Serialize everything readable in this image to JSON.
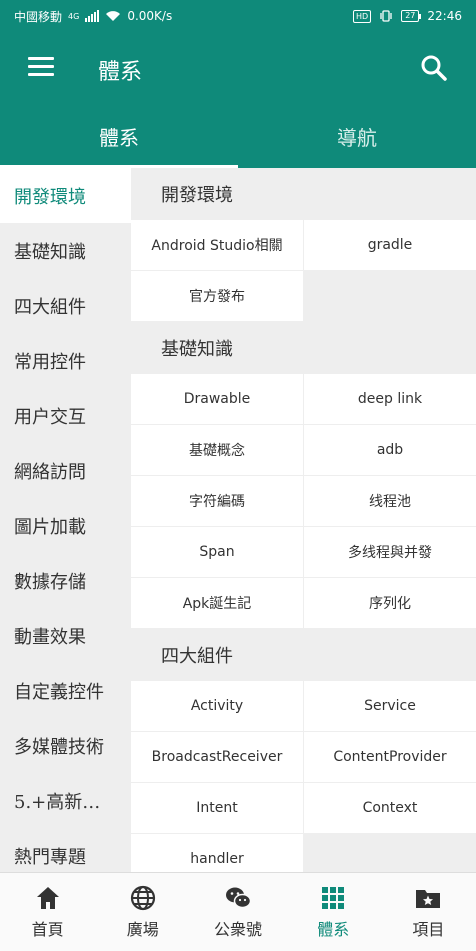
{
  "status_bar": {
    "carrier": "中國移動",
    "network": "4G",
    "speed": "0.00K/s",
    "hd": "HD",
    "battery": "27",
    "time": "22:46"
  },
  "app_bar": {
    "title": "體系",
    "menu_icon": "menu-icon",
    "search_icon": "search-icon",
    "color": "#0f8a7a"
  },
  "top_tabs": [
    {
      "label": "體系",
      "active": true
    },
    {
      "label": "導航",
      "active": false
    }
  ],
  "sidebar": {
    "items": [
      {
        "label": "開發環境",
        "active": true
      },
      {
        "label": "基礎知識"
      },
      {
        "label": "四大組件"
      },
      {
        "label": "常用控件"
      },
      {
        "label": "用户交互"
      },
      {
        "label": "網絡訪問"
      },
      {
        "label": "圖片加載"
      },
      {
        "label": "數據存儲"
      },
      {
        "label": "動畫效果"
      },
      {
        "label": "自定義控件"
      },
      {
        "label": "多媒體技術"
      },
      {
        "label": "5.+高新…"
      },
      {
        "label": "熱門專題"
      }
    ]
  },
  "sections": [
    {
      "title": "開發環境",
      "items": [
        "Android Studio相關",
        "gradle",
        "官方發布"
      ]
    },
    {
      "title": "基礎知識",
      "items": [
        "Drawable",
        "deep link",
        "基礎概念",
        "adb",
        "字符編碼",
        "线程池",
        "Span",
        "多线程與并發",
        "Apk誕生記",
        "序列化"
      ]
    },
    {
      "title": "四大組件",
      "items": [
        "Activity",
        "Service",
        "BroadcastReceiver",
        "ContentProvider",
        "Intent",
        "Context",
        "handler"
      ]
    }
  ],
  "bottom_nav": [
    {
      "label": "首頁",
      "icon": "home-icon"
    },
    {
      "label": "廣場",
      "icon": "globe-icon"
    },
    {
      "label": "公衆號",
      "icon": "wechat-icon"
    },
    {
      "label": "體系",
      "icon": "grid-icon",
      "active": true
    },
    {
      "label": "項目",
      "icon": "folder-star-icon"
    }
  ]
}
